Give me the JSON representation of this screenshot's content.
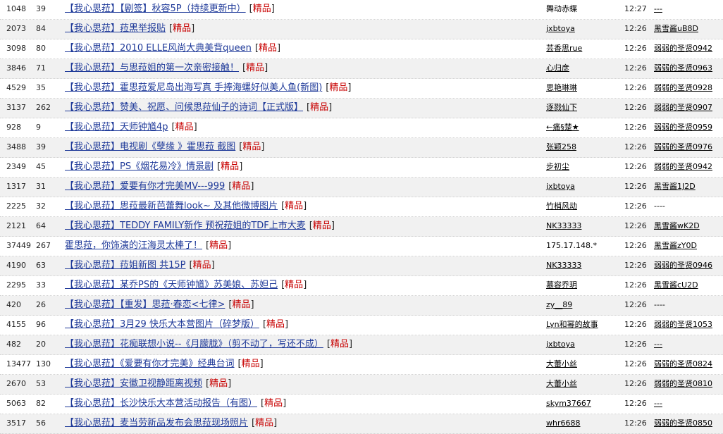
{
  "rows": [
    {
      "views": "1048",
      "replies": "39",
      "title": "【我心思菈】【剧签】秋容5P（持续更新中）",
      "tag": "精品",
      "author": "舞动赤蝶",
      "author_link": false,
      "time": "12:27",
      "last_poster": "---",
      "last_link": true
    },
    {
      "views": "2073",
      "replies": "84",
      "title": "【我心思菈】菈黑举报贴",
      "tag": "精品",
      "author": "jxbtoya",
      "author_link": true,
      "time": "12:26",
      "last_poster": "黑雪酱uB8D",
      "last_link": true
    },
    {
      "views": "3098",
      "replies": "80",
      "title": "【我心思菈】2010 ELLE风尚大典美背queen",
      "tag": "精品",
      "author": "芸香思rue",
      "author_link": true,
      "time": "12:26",
      "last_poster": "弱弱的圣贤0942",
      "last_link": true
    },
    {
      "views": "3846",
      "replies": "71",
      "title": "【我心思菈】与思菈姐的第一次亲密接触！",
      "tag": "精品",
      "author": "心归彦",
      "author_link": true,
      "time": "12:26",
      "last_poster": "弱弱的圣贤0963",
      "last_link": true
    },
    {
      "views": "4529",
      "replies": "35",
      "title": "【我心思菈】霍思菈爱尼岛出海写真 手捧海螺好似美人鱼(新图)",
      "tag": "精品",
      "author": "思艳琳琳",
      "author_link": true,
      "time": "12:26",
      "last_poster": "弱弱的圣贤0928",
      "last_link": true
    },
    {
      "views": "3137",
      "replies": "262",
      "title": "【我心思菈】赞美、祝愿、问候思菈仙子的诗词【正式版】",
      "tag": "精品",
      "author": "逐戮仙下",
      "author_link": true,
      "time": "12:26",
      "last_poster": "弱弱的圣贤0907",
      "last_link": true
    },
    {
      "views": "928",
      "replies": "9",
      "title": "【我心思菈】天师钟馗4p",
      "tag": "精品",
      "author": "←痛§楚★",
      "author_link": true,
      "time": "12:26",
      "last_poster": "弱弱的圣贤0959",
      "last_link": true
    },
    {
      "views": "3488",
      "replies": "39",
      "title": "【我心思菈】电视剧《孽缘 》霍思菈 截图",
      "tag": "精品",
      "author": "张颖258",
      "author_link": true,
      "time": "12:26",
      "last_poster": "弱弱的圣贤0976",
      "last_link": true
    },
    {
      "views": "2349",
      "replies": "45",
      "title": "【我心思菈】PS《烟花易冷》情景剧",
      "tag": "精品",
      "author": "步初尘",
      "author_link": true,
      "time": "12:26",
      "last_poster": "弱弱的圣贤0942",
      "last_link": true
    },
    {
      "views": "1317",
      "replies": "31",
      "title": "【我心思菈】爱要有你才完美MV---999",
      "tag": "精品",
      "author": "jxbtoya",
      "author_link": true,
      "time": "12:26",
      "last_poster": "黑雪酱1J2D",
      "last_link": true
    },
    {
      "views": "2225",
      "replies": "32",
      "title": "【我心思菈】思菈最新芭蕾舞look~ 及其他微博图片",
      "tag": "精品",
      "author": "竹梢风动",
      "author_link": true,
      "time": "12:26",
      "last_poster": "----",
      "last_link": false
    },
    {
      "views": "2121",
      "replies": "64",
      "title": "【我心思菈】TEDDY FAMILY新作 预祝菈姐的TDF上市大麦",
      "tag": "精品",
      "author": "NK33333",
      "author_link": true,
      "time": "12:26",
      "last_poster": "黑雪酱wK2D",
      "last_link": true
    },
    {
      "views": "37449",
      "replies": "267",
      "title": "霍思菈，你饰演的汪海灵太棒了！",
      "tag": "精品",
      "author": "175.17.148.*",
      "author_link": false,
      "time": "12:26",
      "last_poster": "黑雪酱zY0D",
      "last_link": true
    },
    {
      "views": "4190",
      "replies": "63",
      "title": "【我心思菈】菈姐新图 共15P",
      "tag": "精品",
      "author": "NK33333",
      "author_link": true,
      "time": "12:26",
      "last_poster": "弱弱的圣贤0946",
      "last_link": true
    },
    {
      "views": "2295",
      "replies": "33",
      "title": "【我心思菈】某乔PS的《天师钟馗》苏美娘、苏妲己",
      "tag": "精品",
      "author": "慕容乔玥",
      "author_link": true,
      "time": "12:26",
      "last_poster": "黑雪酱cU2D",
      "last_link": true
    },
    {
      "views": "420",
      "replies": "26",
      "title": "【我心思菈】【重发】思菈·春恋<七律>",
      "tag": "精品",
      "author": "zy__89",
      "author_link": true,
      "time": "12:26",
      "last_poster": "----",
      "last_link": false
    },
    {
      "views": "4155",
      "replies": "96",
      "title": "【我心思菈】3月29 快乐大本营图片（碎梦版）",
      "tag": "精品",
      "author": "Lyn和幂的故事",
      "author_link": true,
      "time": "12:26",
      "last_poster": "弱弱的圣贤1053",
      "last_link": true
    },
    {
      "views": "482",
      "replies": "20",
      "title": "【我心思菈】花痴联想小说--《月朦胧》（剪不动了，写还不成）",
      "tag": "精品",
      "author": "jxbtoya",
      "author_link": true,
      "time": "12:26",
      "last_poster": "---",
      "last_link": true
    },
    {
      "views": "13477",
      "replies": "130",
      "title": "【我心思菈】《爱要有你才完美》经典台词",
      "tag": "精品",
      "author": "大蕾小丝",
      "author_link": true,
      "time": "12:26",
      "last_poster": "弱弱的圣贤0824",
      "last_link": true
    },
    {
      "views": "2670",
      "replies": "53",
      "title": "【我心思菈】安徽卫视静距离视频",
      "tag": "精品",
      "author": "大蕾小丝",
      "author_link": true,
      "time": "12:26",
      "last_poster": "弱弱的圣贤0810",
      "last_link": true
    },
    {
      "views": "5063",
      "replies": "82",
      "title": "【我心思菈】长沙快乐大本营活动报告（有图）",
      "tag": "精品",
      "author": "skym37667",
      "author_link": true,
      "time": "12:26",
      "last_poster": "---",
      "last_link": true
    },
    {
      "views": "3517",
      "replies": "56",
      "title": "【我心思菈】麦当劳新品发布会思菈现场照片",
      "tag": "精品",
      "author": "whr6688",
      "author_link": true,
      "time": "12:26",
      "last_poster": "弱弱的圣贤0850",
      "last_link": true
    }
  ]
}
